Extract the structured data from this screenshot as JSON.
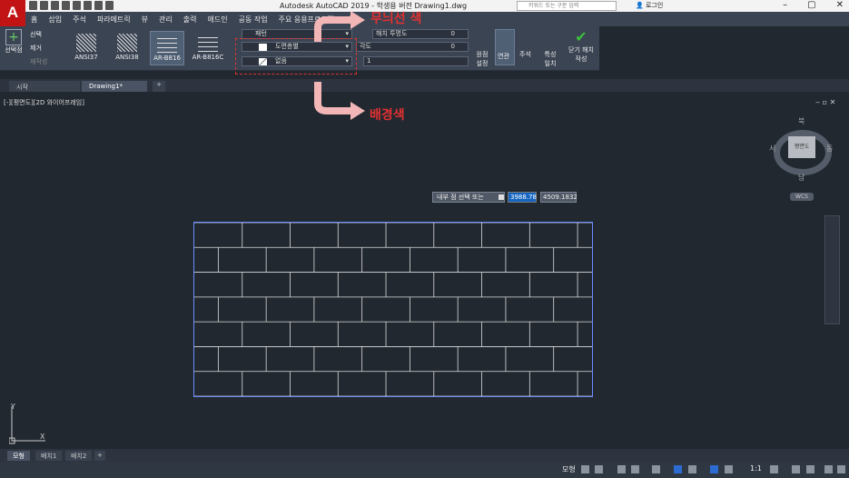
{
  "app": {
    "logo": "A",
    "title": "Autodesk AutoCAD 2019 - 학생용 버전     Drawing1.dwg",
    "search_placeholder": "키워드 또는 구문 입력",
    "login": "로그인"
  },
  "menu": [
    "홈",
    "삽입",
    "주석",
    "파라메트릭",
    "뷰",
    "관리",
    "출력",
    "애드인",
    "공동 작업",
    "주요 응용프로그램",
    "작성"
  ],
  "ribbon": {
    "pick_points": "선택점",
    "select": "선택",
    "remove": "제거",
    "recreate": "재작성",
    "patterns": [
      "ANSI37",
      "ANSI38",
      "AR-B816",
      "AR-B816C"
    ],
    "type_dd": "패턴",
    "color_dd": "도면층별",
    "bg_dd": "없음",
    "transparency_label": "해치 투명도",
    "transparency_val": "0",
    "angle_label": "각도",
    "angle_val": "0",
    "scale_val": "1",
    "origin": "원점 설정",
    "assoc": "연관",
    "annot": "주석",
    "match": "특성 일치",
    "close": "닫기 해치 작성"
  },
  "doc_tabs": [
    "시작",
    "Drawing1*"
  ],
  "viewport": {
    "label": "[-][평면도][2D 와이어프레임]"
  },
  "viewcube": {
    "n": "북",
    "s": "남",
    "e": "동",
    "w": "서",
    "face": "평면도",
    "wcs": "WCS"
  },
  "prompt": {
    "text": "내부 점 선택 또는",
    "x": "3988.78",
    "y": "4509.1832"
  },
  "ucs": {
    "x": "X",
    "y": "Y"
  },
  "layout_tabs": [
    "모형",
    "배치1",
    "배치2"
  ],
  "status": {
    "model": "모형",
    "scale": "1:1"
  },
  "annotations": {
    "hatch_color": "무늬선 색",
    "bg_color": "배경색",
    "color": "#e03131"
  }
}
